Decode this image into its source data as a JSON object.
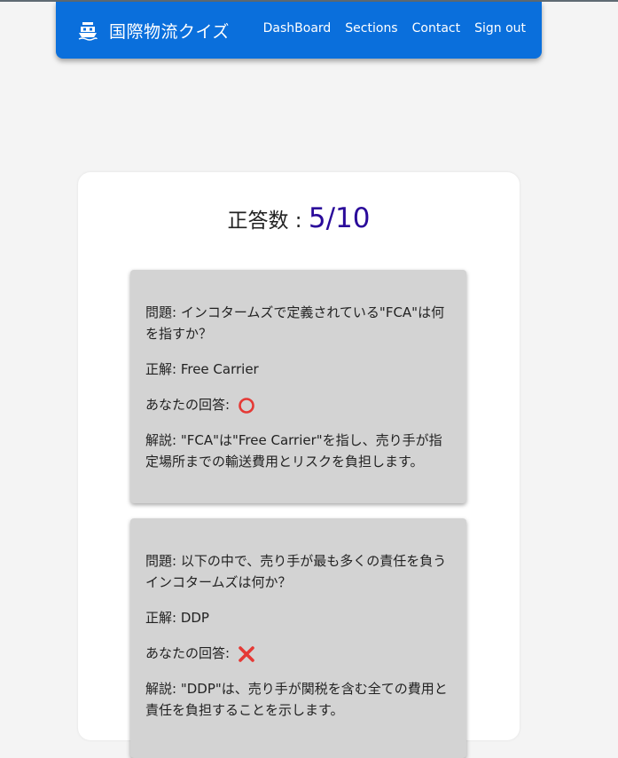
{
  "nav": {
    "brand": "国際物流クイズ",
    "links": [
      "DashBoard",
      "Sections",
      "Contact",
      "Sign out"
    ]
  },
  "score": {
    "label": "正答数 : ",
    "value": "5/10"
  },
  "results": [
    {
      "question": "問題: インコタームズで定義されている\"FCA\"は何を指すか？",
      "answer": "正解: Free Carrier",
      "user_answer_label": "あなたの回答: ",
      "user_answer_icon": "correct-circle-icon",
      "explanation": "解説: \"FCA\"は\"Free Carrier\"を指し、売り手が指定場所までの輸送費用とリスクを負担します。"
    },
    {
      "question": "問題: 以下の中で、売り手が最も多くの責任を負うインコタームズは何か？",
      "answer": "正解: DDP",
      "user_answer_label": "あなたの回答: ",
      "user_answer_icon": "incorrect-cross-icon",
      "explanation": "解説: \"DDP\"は、売り手が関税を含む全ての費用と責任を負担することを示します。"
    }
  ],
  "colors": {
    "navbar": "#0a6fdc",
    "score_value": "#2a0a9a",
    "correct_mark": "#e53935",
    "incorrect_mark": "#e53935"
  }
}
